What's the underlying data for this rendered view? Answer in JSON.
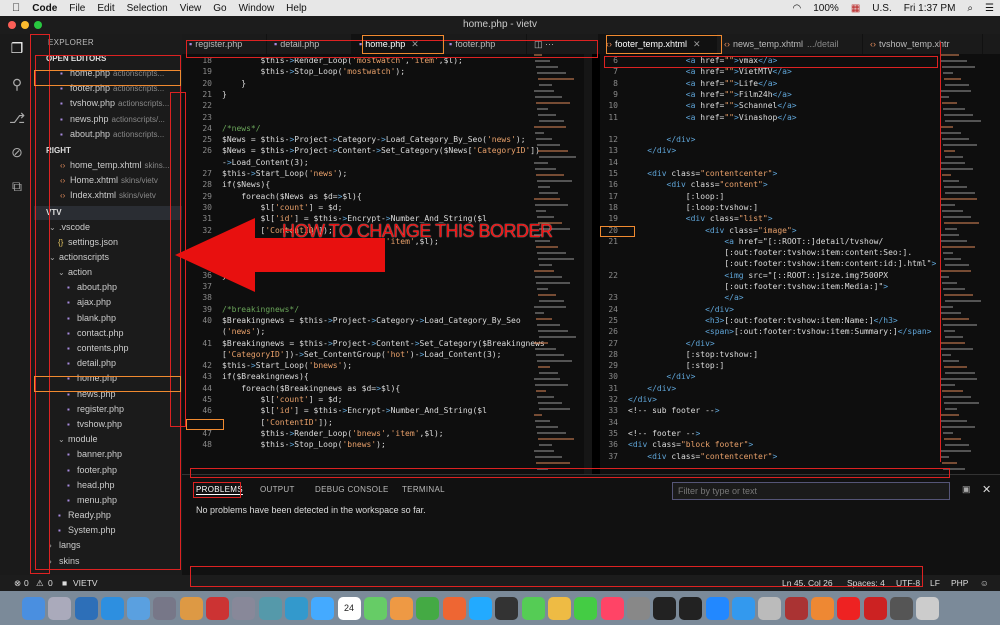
{
  "menubar": {
    "app": "Code",
    "items": [
      "File",
      "Edit",
      "Selection",
      "View",
      "Go",
      "Window",
      "Help"
    ],
    "battery": "100%",
    "locale": "U.S.",
    "clock": "Fri 1:37 PM"
  },
  "window": {
    "title": "home.php - vietv"
  },
  "sidebar": {
    "header": "EXPLORER",
    "open_editors": {
      "title": "OPEN EDITORS",
      "items": [
        {
          "name": "home.php",
          "path": "actionscripts..."
        },
        {
          "name": "footer.php",
          "path": "actionscripts..."
        },
        {
          "name": "tvshow.php",
          "path": "actionscripts..."
        },
        {
          "name": "news.php",
          "path": "actionscripts/..."
        },
        {
          "name": "about.php",
          "path": "actionscripts..."
        }
      ]
    },
    "right": {
      "title": "RIGHT",
      "items": [
        {
          "name": "home_temp.xhtml",
          "path": "skins..."
        },
        {
          "name": "Home.xhtml",
          "path": "skins/vietv"
        },
        {
          "name": "Index.xhtml",
          "path": "skins/vietv"
        }
      ]
    },
    "project": {
      "title": "VTV",
      "tree": [
        {
          "name": ".vscode",
          "kind": "folder",
          "level": 1
        },
        {
          "name": "settings.json",
          "kind": "json",
          "level": 2
        },
        {
          "name": "actionscripts",
          "kind": "folder",
          "level": 1
        },
        {
          "name": "action",
          "kind": "folder",
          "level": 2
        },
        {
          "name": "about.php",
          "kind": "php",
          "level": 3
        },
        {
          "name": "ajax.php",
          "kind": "php",
          "level": 3
        },
        {
          "name": "blank.php",
          "kind": "php",
          "level": 3
        },
        {
          "name": "contact.php",
          "kind": "php",
          "level": 3
        },
        {
          "name": "contents.php",
          "kind": "php",
          "level": 3
        },
        {
          "name": "detail.php",
          "kind": "php",
          "level": 3
        },
        {
          "name": "home.php",
          "kind": "php",
          "level": 3
        },
        {
          "name": "news.php",
          "kind": "php",
          "level": 3
        },
        {
          "name": "register.php",
          "kind": "php",
          "level": 3
        },
        {
          "name": "tvshow.php",
          "kind": "php",
          "level": 3
        },
        {
          "name": "module",
          "kind": "folder",
          "level": 2
        },
        {
          "name": "banner.php",
          "kind": "php",
          "level": 3
        },
        {
          "name": "footer.php",
          "kind": "php",
          "level": 3
        },
        {
          "name": "head.php",
          "kind": "php",
          "level": 3
        },
        {
          "name": "menu.php",
          "kind": "php",
          "level": 3
        },
        {
          "name": "Ready.php",
          "kind": "php",
          "level": 2
        },
        {
          "name": "System.php",
          "kind": "php",
          "level": 2
        },
        {
          "name": "langs",
          "kind": "folder",
          "level": 1
        },
        {
          "name": "skins",
          "kind": "folder",
          "level": 1
        }
      ]
    }
  },
  "tabs_left": [
    {
      "label": "register.php",
      "active": false
    },
    {
      "label": "detail.php",
      "active": false
    },
    {
      "label": "home.php",
      "active": true
    },
    {
      "label": "footer.php",
      "active": false
    }
  ],
  "tabs_right": [
    {
      "label": "footer_temp.xhtml",
      "active": true
    },
    {
      "label": "news_temp.xhtml",
      "extra": ".../detail",
      "active": false
    },
    {
      "label": "tvshow_temp.xhtr",
      "active": false
    }
  ],
  "editor_left": {
    "lines": [
      {
        "n": "18",
        "t": "        $this->Render_Loop('mostwatch','item',$l);"
      },
      {
        "n": "19",
        "t": "        $this->Stop_Loop('mostwatch');"
      },
      {
        "n": "20",
        "t": "    }"
      },
      {
        "n": "21",
        "t": "}"
      },
      {
        "n": "22",
        "t": ""
      },
      {
        "n": "23",
        "t": ""
      },
      {
        "n": "24",
        "t": "/*news*/",
        "cls": "c-com"
      },
      {
        "n": "25",
        "t": "$News = $this->Project->Category->Load_Category_By_Seo('news');"
      },
      {
        "n": "26",
        "t": "$News = $this->Project->Content->Set_Category($News['CategoryID'])"
      },
      {
        "n": "",
        "t": "->Load_Content(3);"
      },
      {
        "n": "27",
        "t": "$this->Start_Loop('news');"
      },
      {
        "n": "28",
        "t": "if($News){"
      },
      {
        "n": "29",
        "t": "    foreach($News as $d=>$l){"
      },
      {
        "n": "30",
        "t": "        $l['count'] = $d;"
      },
      {
        "n": "31",
        "t": "        $l['id'] = $this->Encrypt->Number_And_String($l"
      },
      {
        "n": "32",
        "t": "        ['ContentID']);"
      },
      {
        "n": "",
        "t": "        $this->Render_Loop('news','item',$l);"
      },
      {
        "n": "34",
        "t": "    $this->Stop_Loop('news');"
      },
      {
        "n": "35",
        "t": ""
      },
      {
        "n": "36",
        "t": "}"
      },
      {
        "n": "37",
        "t": ""
      },
      {
        "n": "38",
        "t": ""
      },
      {
        "n": "39",
        "t": "/*breakingnews*/",
        "cls": "c-com"
      },
      {
        "n": "40",
        "t": "$Breakingnews = $this->Project->Category->Load_Category_By_Seo"
      },
      {
        "n": "",
        "t": "('news');"
      },
      {
        "n": "41",
        "t": "$Breakingnews = $this->Project->Content->Set_Category($Breakingnews"
      },
      {
        "n": "",
        "t": "['CategoryID'])->Set_ContentGroup('hot')->Load_Content(3);"
      },
      {
        "n": "42",
        "t": "$this->Start_Loop('bnews');"
      },
      {
        "n": "43",
        "t": "if($Breakingnews){"
      },
      {
        "n": "44",
        "t": "    foreach($Breakingnews as $d=>$l){"
      },
      {
        "n": "45",
        "t": "        $l['count'] = $d;"
      },
      {
        "n": "46",
        "t": "        $l['id'] = $this->Encrypt->Number_And_String($l"
      },
      {
        "n": "",
        "t": "        ['ContentID']);"
      },
      {
        "n": "47",
        "t": "        $this->Render_Loop('bnews','item',$l);"
      },
      {
        "n": "48",
        "t": "        $this->Stop_Loop('bnews');"
      }
    ]
  },
  "editor_right": {
    "lines": [
      {
        "n": "6",
        "t": "            <a href=\"\">vmax</a>"
      },
      {
        "n": "7",
        "t": "            <a href=\"\">VietMTV</a>"
      },
      {
        "n": "8",
        "t": "            <a href=\"\">Life</a>"
      },
      {
        "n": "9",
        "t": "            <a href=\"\">Film24h</a>"
      },
      {
        "n": "10",
        "t": "            <a href=\"\">Schannel</a>"
      },
      {
        "n": "11",
        "t": "            <a href=\"\">Vinashop</a>"
      },
      {
        "n": "",
        "t": ""
      },
      {
        "n": "12",
        "t": "        </div>"
      },
      {
        "n": "13",
        "t": "    </div>"
      },
      {
        "n": "14",
        "t": ""
      },
      {
        "n": "15",
        "t": "    <div class=\"contentcenter\">"
      },
      {
        "n": "16",
        "t": "        <div class=\"content\">"
      },
      {
        "n": "17",
        "t": "            [:loop:]"
      },
      {
        "n": "18",
        "t": "            [:loop:tvshow:]"
      },
      {
        "n": "19",
        "t": "            <div class=\"list\">"
      },
      {
        "n": "20",
        "t": "                <div class=\"image\">"
      },
      {
        "n": "21",
        "t": "                    <a href=\"[::ROOT::]detail/tvshow/"
      },
      {
        "n": "",
        "t": "                    [:out:footer:tvshow:item:content:Seo:]."
      },
      {
        "n": "",
        "t": "                    [:out:footer:tvshow:item:content:id:].html\">"
      },
      {
        "n": "22",
        "t": "                    <img src=\"[::ROOT::]size.img?500PX"
      },
      {
        "n": "",
        "t": "                    [:out:footer:tvshow:item:Media:]\">"
      },
      {
        "n": "23",
        "t": "                    </a>"
      },
      {
        "n": "24",
        "t": "                </div>"
      },
      {
        "n": "25",
        "t": "                <h3>[:out:footer:tvshow:item:Name:]</h3>"
      },
      {
        "n": "26",
        "t": "                <span>[:out:footer:tvshow:item:Summary:]</span>"
      },
      {
        "n": "27",
        "t": "            </div>"
      },
      {
        "n": "28",
        "t": "            [:stop:tvshow:]"
      },
      {
        "n": "29",
        "t": "            [:stop:]"
      },
      {
        "n": "30",
        "t": "        </div>"
      },
      {
        "n": "31",
        "t": "    </div>"
      },
      {
        "n": "32",
        "t": "</div>"
      },
      {
        "n": "33",
        "t": "<!-- sub footer -->"
      },
      {
        "n": "34",
        "t": ""
      },
      {
        "n": "35",
        "t": "<!-- footer -->"
      },
      {
        "n": "36",
        "t": "<div class=\"block footer\">"
      },
      {
        "n": "37",
        "t": "    <div class=\"contentcenter\">"
      }
    ]
  },
  "panel": {
    "tabs": [
      "PROBLEMS",
      "OUTPUT",
      "DEBUG CONSOLE",
      "TERMINAL"
    ],
    "filter_placeholder": "Filter by type or text",
    "message": "No problems have been detected in the workspace so far."
  },
  "status": {
    "errors": "0",
    "warnings": "0",
    "folder": "VIETV",
    "position": "Ln 45, Col 26",
    "spaces": "Spaces: 4",
    "encoding": "UTF-8",
    "eol": "LF",
    "language": "PHP"
  },
  "annotation": {
    "text": "HOW TO CHANGE THIS BORDER"
  },
  "dock": {
    "items": [
      "finder",
      "launchpad",
      "photoshop",
      "vscode",
      "safari",
      "rocket",
      "preview",
      "filezilla",
      "disk-utility",
      "sql",
      "mysql",
      "xcode",
      "calendar",
      "maps",
      "photos",
      "chrome",
      "firefox",
      "skype",
      "terminal-like",
      "facetime",
      "notes",
      "messages",
      "itunes",
      "preferences",
      "activity",
      "terminal",
      "appstore",
      "translate",
      "apple",
      "dictionary",
      "books",
      "youtube",
      "opera",
      "alien",
      "trash"
    ],
    "calendar_day": "24"
  }
}
